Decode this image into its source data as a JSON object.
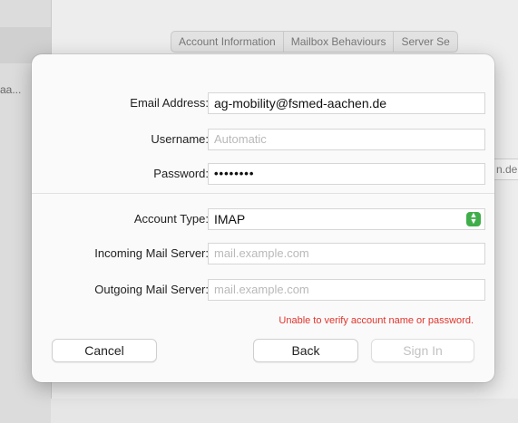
{
  "background": {
    "sidebar_text": "aa...",
    "tabs": [
      "Account Information",
      "Mailbox Behaviours",
      "Server Se"
    ],
    "right_field_text": "n.de"
  },
  "dialog": {
    "email": {
      "label": "Email Address:",
      "value": "ag-mobility@fsmed-aachen.de"
    },
    "username": {
      "label": "Username:",
      "placeholder": "Automatic"
    },
    "password": {
      "label": "Password:",
      "value": "••••••••"
    },
    "account_type": {
      "label": "Account Type:",
      "value": "IMAP",
      "control_color": "#3fae4a"
    },
    "incoming": {
      "label": "Incoming Mail Server:",
      "placeholder": "mail.example.com"
    },
    "outgoing": {
      "label": "Outgoing Mail Server:",
      "placeholder": "mail.example.com"
    },
    "error_text": "Unable to verify account name or password.",
    "error_color": "#e0342c",
    "buttons": {
      "cancel": "Cancel",
      "back": "Back",
      "sign_in": "Sign In"
    }
  }
}
